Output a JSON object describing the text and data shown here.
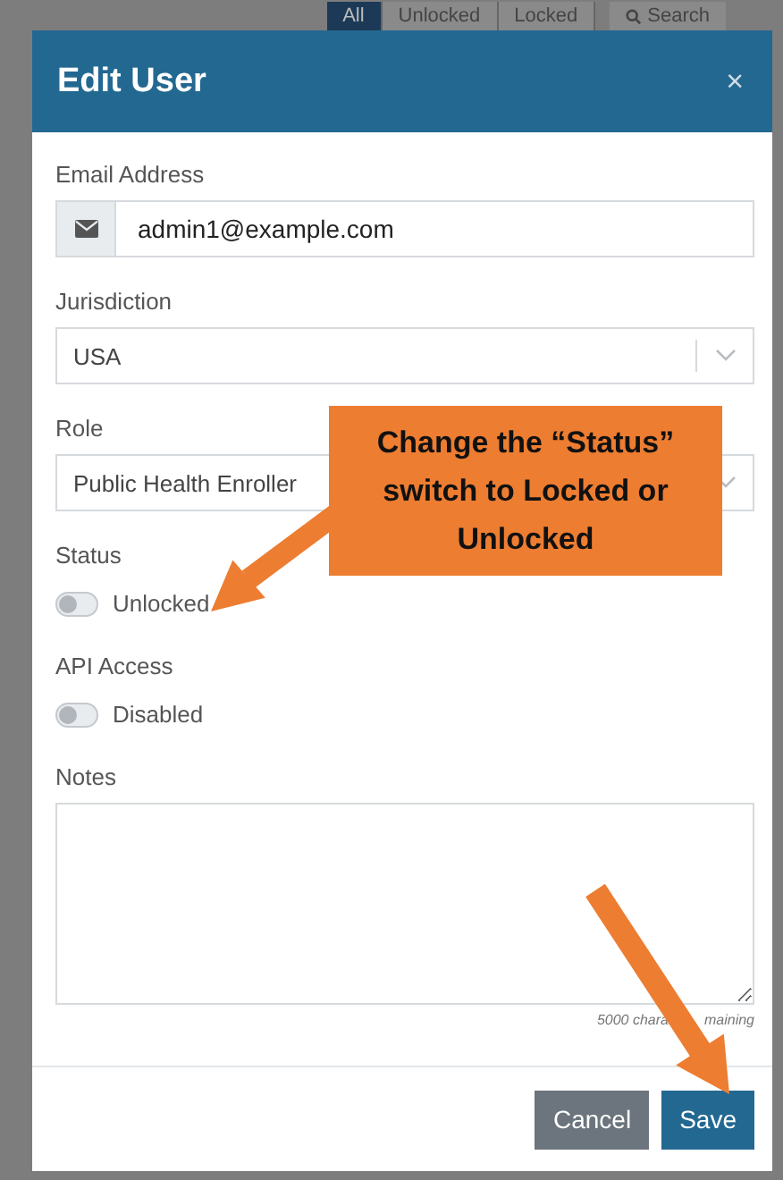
{
  "background_tabs": [
    {
      "label": "All",
      "selected": true
    },
    {
      "label": "Unlocked",
      "selected": false
    },
    {
      "label": "Locked",
      "selected": false
    }
  ],
  "background_search": {
    "label": "Search"
  },
  "dialog": {
    "title": "Edit User",
    "close": "×"
  },
  "email": {
    "label": "Email Address",
    "value": "admin1@example.com"
  },
  "jurisdiction": {
    "label": "Jurisdiction",
    "value": "USA"
  },
  "role": {
    "label": "Role",
    "value": "Public Health Enroller"
  },
  "status": {
    "label": "Status",
    "on": false,
    "text": "Unlocked"
  },
  "api_access": {
    "label": "API Access",
    "on": false,
    "text": "Disabled"
  },
  "notes": {
    "label": "Notes",
    "counter_parts": [
      "5000 chara",
      "maining"
    ]
  },
  "buttons": [
    {
      "label": "Cancel",
      "kind": "secondary"
    },
    {
      "label": "Save",
      "kind": "primary"
    }
  ],
  "callout": {
    "text": "Change the “Status” switch to Locked or Unlocked"
  }
}
